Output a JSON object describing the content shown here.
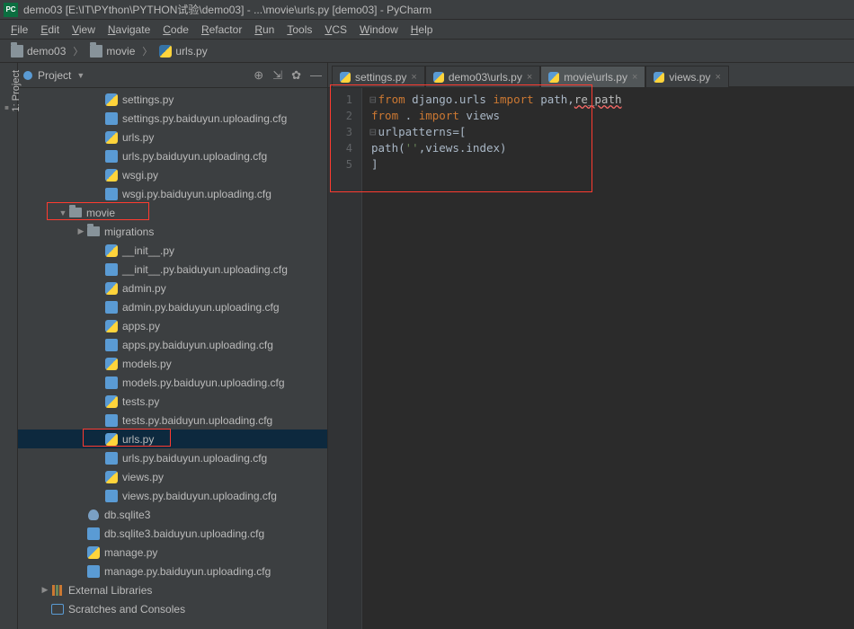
{
  "window": {
    "title": "demo03 [E:\\IT\\PYthon\\PYTHON试验\\demo03] - ...\\movie\\urls.py [demo03] - PyCharm"
  },
  "menu": {
    "items": [
      "File",
      "Edit",
      "View",
      "Navigate",
      "Code",
      "Refactor",
      "Run",
      "Tools",
      "VCS",
      "Window",
      "Help"
    ]
  },
  "breadcrumb": {
    "items": [
      {
        "icon": "folder",
        "label": "demo03"
      },
      {
        "icon": "folder",
        "label": "movie"
      },
      {
        "icon": "py",
        "label": "urls.py"
      }
    ]
  },
  "sidebar": {
    "strip_label": "1: Project"
  },
  "project_panel": {
    "title": "Project"
  },
  "tree": {
    "rows": [
      {
        "indent": 4,
        "arrow": "",
        "icon": "py",
        "label": "settings.py"
      },
      {
        "indent": 4,
        "arrow": "",
        "icon": "cfg",
        "label": "settings.py.baiduyun.uploading.cfg"
      },
      {
        "indent": 4,
        "arrow": "",
        "icon": "py",
        "label": "urls.py"
      },
      {
        "indent": 4,
        "arrow": "",
        "icon": "cfg",
        "label": "urls.py.baiduyun.uploading.cfg"
      },
      {
        "indent": 4,
        "arrow": "",
        "icon": "py",
        "label": "wsgi.py"
      },
      {
        "indent": 4,
        "arrow": "",
        "icon": "cfg",
        "label": "wsgi.py.baiduyun.uploading.cfg"
      },
      {
        "indent": 2,
        "arrow": "down",
        "icon": "folder",
        "label": "movie",
        "hl": "movie"
      },
      {
        "indent": 3,
        "arrow": "right",
        "icon": "folder",
        "label": "migrations"
      },
      {
        "indent": 4,
        "arrow": "",
        "icon": "py",
        "label": "__init__.py"
      },
      {
        "indent": 4,
        "arrow": "",
        "icon": "cfg",
        "label": "__init__.py.baiduyun.uploading.cfg"
      },
      {
        "indent": 4,
        "arrow": "",
        "icon": "py",
        "label": "admin.py"
      },
      {
        "indent": 4,
        "arrow": "",
        "icon": "cfg",
        "label": "admin.py.baiduyun.uploading.cfg"
      },
      {
        "indent": 4,
        "arrow": "",
        "icon": "py",
        "label": "apps.py"
      },
      {
        "indent": 4,
        "arrow": "",
        "icon": "cfg",
        "label": "apps.py.baiduyun.uploading.cfg"
      },
      {
        "indent": 4,
        "arrow": "",
        "icon": "py",
        "label": "models.py"
      },
      {
        "indent": 4,
        "arrow": "",
        "icon": "cfg",
        "label": "models.py.baiduyun.uploading.cfg"
      },
      {
        "indent": 4,
        "arrow": "",
        "icon": "py",
        "label": "tests.py"
      },
      {
        "indent": 4,
        "arrow": "",
        "icon": "cfg",
        "label": "tests.py.baiduyun.uploading.cfg"
      },
      {
        "indent": 4,
        "arrow": "",
        "icon": "py",
        "label": "urls.py",
        "selected": true,
        "hl": "urls"
      },
      {
        "indent": 4,
        "arrow": "",
        "icon": "cfg",
        "label": "urls.py.baiduyun.uploading.cfg"
      },
      {
        "indent": 4,
        "arrow": "",
        "icon": "py",
        "label": "views.py"
      },
      {
        "indent": 4,
        "arrow": "",
        "icon": "cfg",
        "label": "views.py.baiduyun.uploading.cfg"
      },
      {
        "indent": 3,
        "arrow": "",
        "icon": "db",
        "label": "db.sqlite3"
      },
      {
        "indent": 3,
        "arrow": "",
        "icon": "cfg",
        "label": "db.sqlite3.baiduyun.uploading.cfg"
      },
      {
        "indent": 3,
        "arrow": "",
        "icon": "py",
        "label": "manage.py"
      },
      {
        "indent": 3,
        "arrow": "",
        "icon": "cfg",
        "label": "manage.py.baiduyun.uploading.cfg"
      },
      {
        "indent": 1,
        "arrow": "right",
        "icon": "lib",
        "label": "External Libraries"
      },
      {
        "indent": 1,
        "arrow": "",
        "icon": "scratch",
        "label": "Scratches and Consoles"
      }
    ]
  },
  "editor_tabs": {
    "tabs": [
      {
        "label": "settings.py",
        "active": false
      },
      {
        "label": "demo03\\urls.py",
        "active": false
      },
      {
        "label": "movie\\urls.py",
        "active": true
      },
      {
        "label": "views.py",
        "active": false
      }
    ]
  },
  "editor": {
    "line_numbers": [
      "1",
      "2",
      "3",
      "4",
      "5"
    ],
    "lines": [
      [
        {
          "cls": "kw",
          "t": "from "
        },
        {
          "cls": "id",
          "t": "django"
        },
        {
          "cls": "op",
          "t": "."
        },
        {
          "cls": "id",
          "t": "urls "
        },
        {
          "cls": "kw",
          "t": "import "
        },
        {
          "cls": "id",
          "t": "path"
        },
        {
          "cls": "op",
          "t": ","
        },
        {
          "cls": "err",
          "t": "re_path"
        }
      ],
      [
        {
          "cls": "kw",
          "t": "from "
        },
        {
          "cls": "op",
          "t": ". "
        },
        {
          "cls": "kw",
          "t": "import "
        },
        {
          "cls": "id",
          "t": "views"
        }
      ],
      [
        {
          "cls": "id",
          "t": "urlpatterns"
        },
        {
          "cls": "op",
          "t": "="
        },
        {
          "cls": "op",
          "t": "["
        }
      ],
      [
        {
          "cls": "id",
          "t": "    path"
        },
        {
          "cls": "op",
          "t": "("
        },
        {
          "cls": "str",
          "t": "''"
        },
        {
          "cls": "op",
          "t": ","
        },
        {
          "cls": "id",
          "t": "views"
        },
        {
          "cls": "op",
          "t": "."
        },
        {
          "cls": "id",
          "t": "index"
        },
        {
          "cls": "op",
          "t": ")"
        }
      ],
      [
        {
          "cls": "op",
          "t": "]"
        }
      ]
    ]
  }
}
